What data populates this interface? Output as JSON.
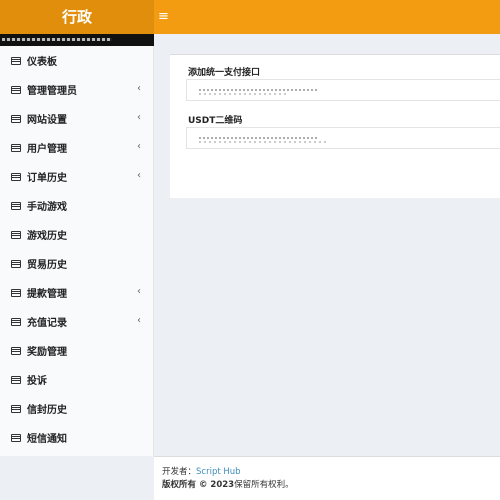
{
  "header": {
    "brand": "行政",
    "menu_icon": "≡"
  },
  "sidebar": {
    "items": [
      {
        "label": "仪表板",
        "has_submenu": false
      },
      {
        "label": "管理管理员",
        "has_submenu": true
      },
      {
        "label": "网站设置",
        "has_submenu": true
      },
      {
        "label": "用户管理",
        "has_submenu": true
      },
      {
        "label": "订单历史",
        "has_submenu": true
      },
      {
        "label": "手动游戏",
        "has_submenu": false
      },
      {
        "label": "游戏历史",
        "has_submenu": false
      },
      {
        "label": "贸易历史",
        "has_submenu": false
      },
      {
        "label": "提款管理",
        "has_submenu": true
      },
      {
        "label": "充值记录",
        "has_submenu": true
      },
      {
        "label": "奖励管理",
        "has_submenu": false
      },
      {
        "label": "投诉",
        "has_submenu": false
      },
      {
        "label": "信封历史",
        "has_submenu": false
      },
      {
        "label": "短信通知",
        "has_submenu": false
      }
    ],
    "chevron": "‹"
  },
  "main": {
    "field1_label": "添加统一支付接口",
    "field2_label": "USDT二维码"
  },
  "footer": {
    "dev_prefix": "开发者：",
    "dev_name": "Script Hub",
    "copyright_bold": "版权所有 © 2023",
    "copyright_rest": "保留所有权利。"
  },
  "colors": {
    "header": "#f39c12",
    "brand_bg": "#e08e0b",
    "link": "#3c8dbc"
  }
}
